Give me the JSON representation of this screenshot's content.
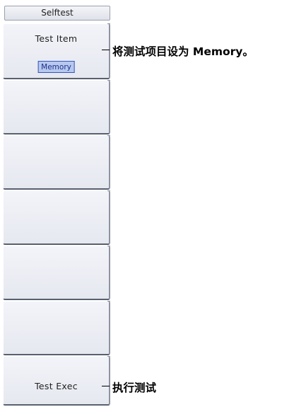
{
  "menu": {
    "title": "Selftest"
  },
  "softkeys": [
    {
      "label": "Test Item",
      "value": "Memory"
    },
    {
      "label": ""
    },
    {
      "label": ""
    },
    {
      "label": ""
    },
    {
      "label": ""
    },
    {
      "label": ""
    },
    {
      "label": "Test Exec"
    }
  ],
  "callouts": {
    "test_item": "将测试项目设为 Memory。",
    "test_exec": "执行测试"
  }
}
